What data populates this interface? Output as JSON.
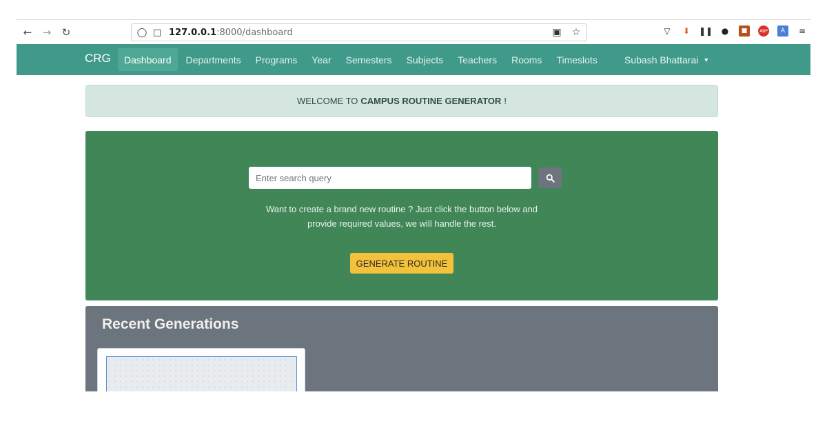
{
  "browser": {
    "url_host": "127.0.0.1",
    "url_rest": ":8000/dashboard",
    "back_icon": "arrow-left-icon",
    "forward_icon": "arrow-right-icon",
    "reload_icon": "reload-icon"
  },
  "navbar": {
    "brand": "CRG",
    "items": [
      {
        "label": "Dashboard",
        "active": true
      },
      {
        "label": "Departments"
      },
      {
        "label": "Programs"
      },
      {
        "label": "Year"
      },
      {
        "label": "Semesters"
      },
      {
        "label": "Subjects"
      },
      {
        "label": "Teachers"
      },
      {
        "label": "Rooms"
      },
      {
        "label": "Timeslots"
      }
    ],
    "user": "Subash Bhattarai",
    "color": "#3f9a8a"
  },
  "alert": {
    "prefix": "WELCOME TO",
    "emphasis": "CAMPUS ROUTINE GENERATOR",
    "suffix": "!"
  },
  "hero": {
    "search_placeholder": "Enter search query",
    "description_line1": "Want to create a brand new routine ? Just click the button below and",
    "description_line2": "provide required values, we will handle the rest.",
    "button_label": "GENERATE ROUTINE",
    "color": "#408657",
    "button_color": "#f4c13a"
  },
  "recent": {
    "title": "Recent Generations",
    "color": "#6c757d"
  }
}
